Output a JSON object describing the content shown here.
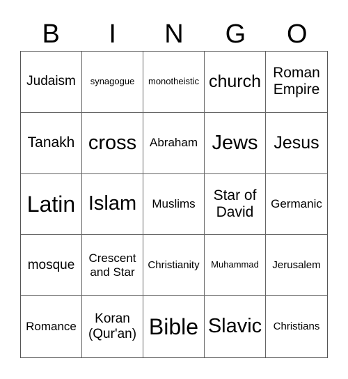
{
  "header": [
    "B",
    "I",
    "N",
    "G",
    "O"
  ],
  "cells": [
    "Judaism",
    "synagogue",
    "monotheistic",
    "church",
    "Roman Empire",
    "Tanakh",
    "cross",
    "Abraham",
    "Jews",
    "Jesus",
    "Latin",
    "Islam",
    "Muslims",
    "Star of David",
    "Germanic",
    "mosque",
    "Crescent and Star",
    "Christianity",
    "Muhammad",
    "Jerusalem",
    "Romance",
    "Koran (Qur'an)",
    "Bible",
    "Slavic",
    "Christians"
  ]
}
